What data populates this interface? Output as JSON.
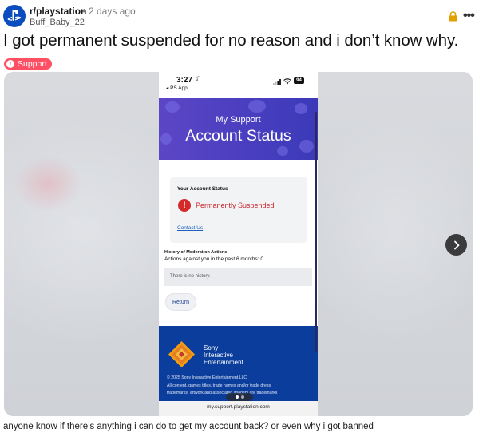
{
  "post": {
    "subreddit": "r/playstation",
    "separator": "•",
    "age": "2 days ago",
    "author": "Buff_Baby_22",
    "title": "I got permanent suspended for no reason and i don’t know why.",
    "flair": "Support",
    "flair_icon": "!",
    "body": "anyone know if there’s anything i can do to get my account back? or even why i got banned",
    "more_icon": "•••",
    "icons": {
      "subreddit_avatar": "playstation-logo-icon",
      "lock": "lock-icon",
      "more": "more-options-icon",
      "next": "chevron-right-icon"
    }
  },
  "screenshot": {
    "status_bar": {
      "time": "3:27",
      "moon": "☾",
      "back_app": "◂ PS App",
      "battery": "94"
    },
    "hero": {
      "subtitle": "My Support",
      "title": "Account Status"
    },
    "status_card": {
      "heading": "Your Account Status",
      "alert_icon": "!",
      "status": "Permanently Suspended",
      "contact_link": "Contact Us"
    },
    "history": {
      "heading": "History of Moderation Actions",
      "count_text": "Actions against you in the past 6 months: 0",
      "empty_text": "There is no history."
    },
    "return_button": "Return",
    "footer": {
      "brand_line1": "Sony",
      "brand_line2": "Interactive",
      "brand_line3": "Entertainment",
      "copyright_line1": "© 2025 Sony Interactive Entertainment LLC",
      "copyright_line2": "All content, games titles, trade names and/or trade dress,",
      "copyright_line3": "trademarks, artwork and associated imagery are trademarks"
    },
    "url": "my.support.playstation.com"
  },
  "colors": {
    "flair": "#ff4f64",
    "subreddit_avatar": "#0b4dbf",
    "hero_purple": "#4b3fc0",
    "footer_blue": "#0a3d9c",
    "suspended_red": "#c9252c"
  }
}
